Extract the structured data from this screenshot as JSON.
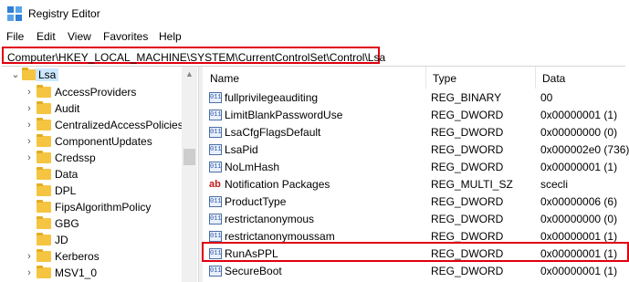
{
  "window": {
    "title": "Registry Editor"
  },
  "menu": [
    "File",
    "Edit",
    "View",
    "Favorites",
    "Help"
  ],
  "address": {
    "path": "Computer\\HKEY_LOCAL_MACHINE\\SYSTEM\\CurrentControlSet\\Control\\Lsa"
  },
  "tree": {
    "selected": "Lsa",
    "children": [
      "AccessProviders",
      "Audit",
      "CentralizedAccessPolicies",
      "ComponentUpdates",
      "Credssp",
      "Data",
      "DPL",
      "FipsAlgorithmPolicy",
      "GBG",
      "JD",
      "Kerberos",
      "MSV1_0"
    ]
  },
  "columns": {
    "name": "Name",
    "type": "Type",
    "data": "Data"
  },
  "values": [
    {
      "name": "fullprivilegeauditing",
      "type": "REG_BINARY",
      "data": "00",
      "icon": "binary-value-icon"
    },
    {
      "name": "LimitBlankPasswordUse",
      "type": "REG_DWORD",
      "data": "0x00000001 (1)",
      "icon": "binary-value-icon"
    },
    {
      "name": "LsaCfgFlagsDefault",
      "type": "REG_DWORD",
      "data": "0x00000000 (0)",
      "icon": "binary-value-icon"
    },
    {
      "name": "LsaPid",
      "type": "REG_DWORD",
      "data": "0x000002e0 (736)",
      "icon": "binary-value-icon"
    },
    {
      "name": "NoLmHash",
      "type": "REG_DWORD",
      "data": "0x00000001 (1)",
      "icon": "binary-value-icon"
    },
    {
      "name": "Notification Packages",
      "type": "REG_MULTI_SZ",
      "data": "scecli",
      "icon": "string-value-icon"
    },
    {
      "name": "ProductType",
      "type": "REG_DWORD",
      "data": "0x00000006 (6)",
      "icon": "binary-value-icon"
    },
    {
      "name": "restrictanonymous",
      "type": "REG_DWORD",
      "data": "0x00000000 (0)",
      "icon": "binary-value-icon"
    },
    {
      "name": "restrictanonymoussam",
      "type": "REG_DWORD",
      "data": "0x00000001 (1)",
      "icon": "binary-value-icon"
    },
    {
      "name": "RunAsPPL",
      "type": "REG_DWORD",
      "data": "0x00000001 (1)",
      "icon": "binary-value-icon"
    },
    {
      "name": "SecureBoot",
      "type": "REG_DWORD",
      "data": "0x00000001 (1)",
      "icon": "binary-value-icon"
    }
  ],
  "colors": {
    "highlight": "#e0000f",
    "selection": "#cce8ff",
    "folder": "#f5c542"
  }
}
